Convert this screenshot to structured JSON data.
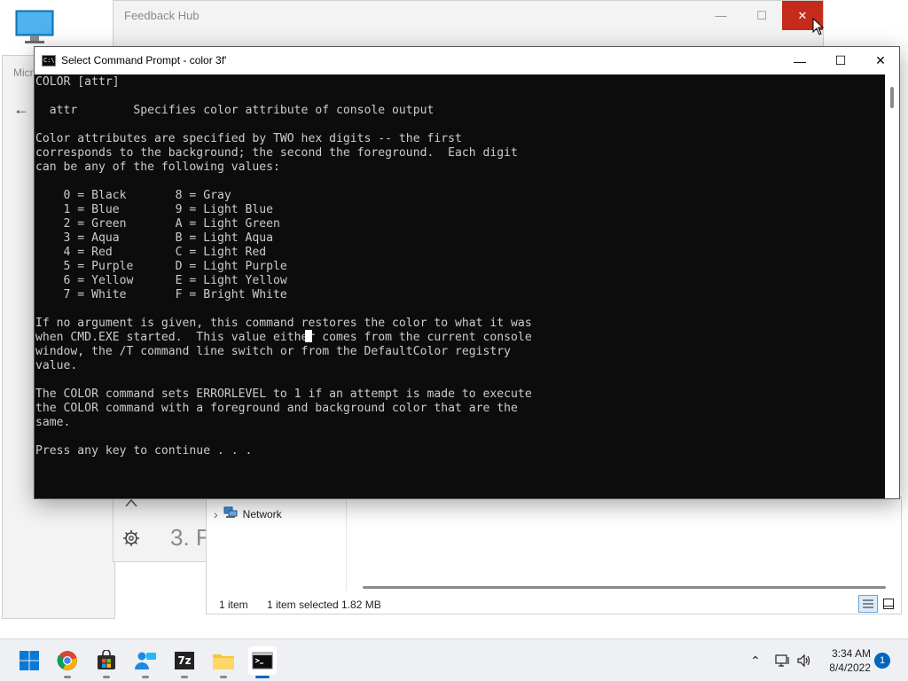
{
  "desktop": {
    "icon_name": "this-pc-icon"
  },
  "feedback_hub": {
    "title": "Feedback Hub",
    "minimize": "—",
    "maximize": "☐",
    "close": "✕",
    "partial_heading": "3. F"
  },
  "ms_window": {
    "title": "Micr",
    "back": "←"
  },
  "cmd": {
    "title": "Select Command Prompt - color  3f'",
    "icon_text": "C:\\",
    "minimize": "—",
    "maximize": "☐",
    "close": "✕",
    "output": "COLOR [attr]\n\n  attr        Specifies color attribute of console output\n\nColor attributes are specified by TWO hex digits -- the first\ncorresponds to the background; the second the foreground.  Each digit\ncan be any of the following values:\n\n    0 = Black       8 = Gray\n    1 = Blue        9 = Light Blue\n    2 = Green       A = Light Green\n    3 = Aqua        B = Light Aqua\n    4 = Red         C = Light Red\n    5 = Purple      D = Light Purple\n    6 = Yellow      E = Light Yellow\n    7 = White       F = Bright White\n\nIf no argument is given, this command restores the color to what it was\nwhen CMD.EXE started.  This value either comes from the current console\nwindow, the /T command line switch or from the DefaultColor registry\nvalue.\n\nThe COLOR command sets ERRORLEVEL to 1 if an attempt is made to execute\nthe COLOR command with a foreground and background color that are the\nsame.\n\nPress any key to continue . . ."
  },
  "explorer": {
    "nav_chevron": "›",
    "network_label": "Network",
    "status_items": "1 item",
    "status_selected": "1 item selected  1.82 MB"
  },
  "taskbar": {
    "apps": [
      "start-icon",
      "chrome-icon",
      "store-icon",
      "people-icon",
      "7zip-icon",
      "file-explorer-icon",
      "command-prompt-icon"
    ],
    "tray_chevron": "⌃",
    "time": "3:34 AM",
    "date": "8/4/2022",
    "notifications": "1",
    "seven_zip_label": "7z"
  },
  "colors": {
    "console_bg": "#0c0c0c",
    "console_fg": "#cccccc",
    "close_red": "#c42b1c",
    "accent": "#0067c0"
  }
}
